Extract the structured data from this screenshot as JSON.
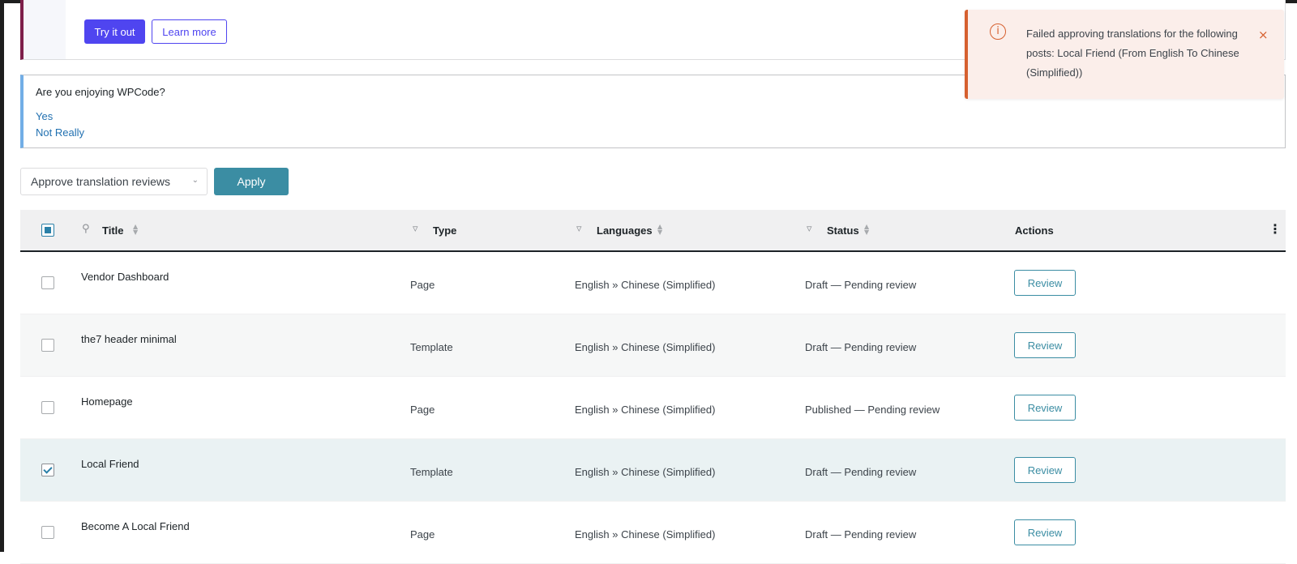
{
  "promo": {
    "try_label": "Try it out",
    "learn_label": "Learn more"
  },
  "wpcode_notice": {
    "question": "Are you enjoying WPCode?",
    "yes": "Yes",
    "no": "Not Really"
  },
  "toast": {
    "message": "Failed approving translations for the following posts: Local Friend (From English To Chinese (Simplified))",
    "icon": "info-circle-icon",
    "close_symbol": "×"
  },
  "bulk": {
    "selected_action": "Approve translation reviews",
    "apply_label": "Apply"
  },
  "table": {
    "headers": {
      "title": "Title",
      "type": "Type",
      "languages": "Languages",
      "status": "Status",
      "actions": "Actions"
    },
    "rows": [
      {
        "title": "Vendor Dashboard",
        "type": "Page",
        "languages": "English » Chinese (Simplified)",
        "status": "Draft — Pending review",
        "action": "Review",
        "checked": false
      },
      {
        "title": "the7 header minimal",
        "type": "Template",
        "languages": "English » Chinese (Simplified)",
        "status": "Draft — Pending review",
        "action": "Review",
        "checked": false
      },
      {
        "title": "Homepage",
        "type": "Page",
        "languages": "English » Chinese (Simplified)",
        "status": "Published — Pending review",
        "action": "Review",
        "checked": false
      },
      {
        "title": "Local Friend",
        "type": "Template",
        "languages": "English » Chinese (Simplified)",
        "status": "Draft — Pending review",
        "action": "Review",
        "checked": true
      },
      {
        "title": "Become A Local Friend",
        "type": "Page",
        "languages": "English » Chinese (Simplified)",
        "status": "Draft — Pending review",
        "action": "Review",
        "checked": false
      }
    ]
  },
  "colors": {
    "primary": "#4f45f0",
    "accent": "#3b8da3",
    "error": "#d6602f",
    "notice_border": "#72aee6",
    "promo_border": "#7e1f4a"
  }
}
